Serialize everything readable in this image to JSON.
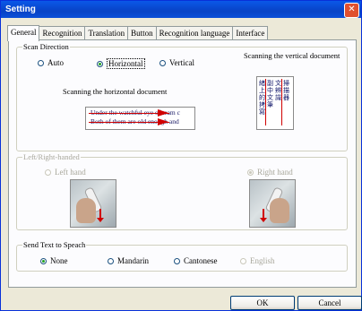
{
  "window": {
    "title": "Setting",
    "close_glyph": "✕"
  },
  "tabs": [
    "General",
    "Recognition",
    "Translation",
    "Button",
    "Recognition language",
    "Interface"
  ],
  "scan_direction": {
    "legend": "Scan Direction",
    "options": [
      "Auto",
      "Horizontal",
      "Vertical"
    ],
    "selected": "Horizontal",
    "vertical_doc_label": "Scanning the vertical document",
    "horizontal_doc_label": "Scanning the horizontal document",
    "horizontal_sample_lines": [
      "Under the watchful eye of team c",
      "Both of them are old enough and"
    ],
    "vertical_sample_columns": [
      "緒上的拷寫",
      "副中文筆",
      "文辨識",
      "掃描器"
    ]
  },
  "handedness": {
    "legend": "Left/Right-handed",
    "options": [
      "Left hand",
      "Right hand"
    ],
    "selected": "Right hand",
    "enabled": false
  },
  "speech": {
    "legend": "Send Text to Speach",
    "options": [
      "None",
      "Mandarin",
      "Cantonese",
      "English"
    ],
    "selected": "None",
    "disabled_options": [
      "English"
    ]
  },
  "buttons": {
    "ok": "OK",
    "cancel": "Cancel"
  },
  "colors": {
    "titlebar": "#0A58E8",
    "close": "#E0502F",
    "arrow": "#D00000"
  }
}
